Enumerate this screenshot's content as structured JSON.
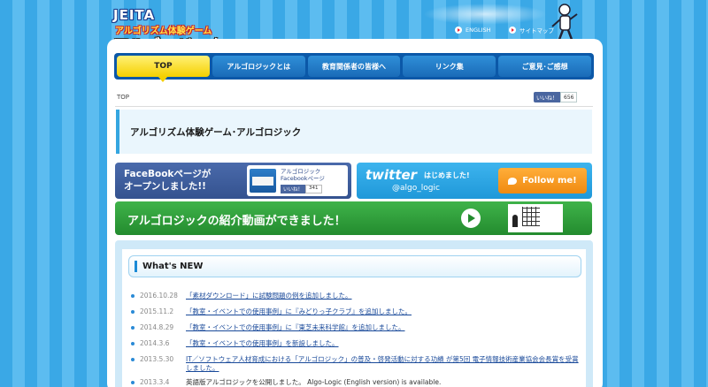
{
  "header": {
    "logo_top": "JEITA",
    "logo_sub": "アルゴリズム体験ゲーム",
    "logo_main": "アルゴロジック",
    "link_english": "ENGLISH",
    "link_sitemap": "サイトマップ"
  },
  "nav": {
    "items": [
      "TOP",
      "アルゴロジックとは",
      "教育関係者の皆様へ",
      "リンク集",
      "ご意見･ご感想"
    ]
  },
  "breadcrumb": "TOP",
  "like": {
    "label": "いいね！",
    "count": "656"
  },
  "page_title": "アルゴリズム体験ゲーム･アルゴロジック",
  "facebook_banner": {
    "text": "FaceBookページが\nオープンしました!!",
    "card_title": "アルゴロジック\nFacebookページ",
    "card_like_label": "いいね！",
    "card_like_count": "341"
  },
  "twitter_banner": {
    "logo": "twitter",
    "tagline": "はじめました!",
    "handle": "@algo_logic",
    "follow_label": "Follow me!"
  },
  "video_banner": {
    "text": "アルゴロジックの紹介動画ができました！"
  },
  "news": {
    "heading": "What's NEW",
    "items": [
      {
        "date": "2016.10.28",
        "text": "「素材ダウンロード」に試験問題の例を追加しました。"
      },
      {
        "date": "2015.11.2",
        "text": "「教室・イベントでの使用事例」に『みどりっ子クラブ』を追加しました。"
      },
      {
        "date": "2014.8.29",
        "text": "「教室・イベントでの使用事例」に『東芝未来科学館』を追加しました。"
      },
      {
        "date": "2014.3.6",
        "text": "「教室・イベントでの使用事例」を新設しました。"
      },
      {
        "date": "2013.5.30",
        "text": "IT／ソフトウェア人材育成における「アルゴロジック」の普及・啓発活動に対する功績 が第5回 電子情報技術産業協会会長賞を受賞しました。"
      },
      {
        "date": "2013.3.4",
        "text": "英語版アルゴロジックを公開しました。 Algo-Logic (English version) is available."
      }
    ]
  },
  "colors": {
    "stripe_dark": "#3aa8e6",
    "stripe_light": "#5cbcf0",
    "nav_bg": "#0b58a8",
    "nav_active": "#f5d000",
    "facebook": "#3b5998",
    "twitter": "#1f98d9",
    "follow": "#f08a10",
    "video": "#2e9e3a"
  }
}
